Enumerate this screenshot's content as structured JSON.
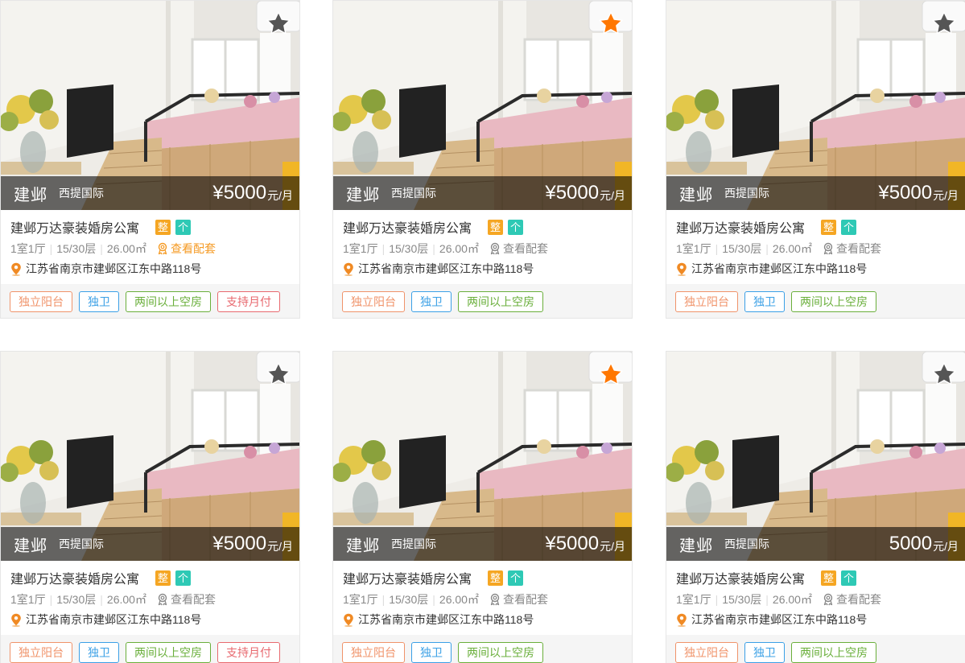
{
  "colors": {
    "accent_orange": "#f5a623",
    "accent_teal": "#2ec9b5",
    "star_active": "#ff7700",
    "star_inactive": "#555555",
    "tag_orange": "#f0936a",
    "tag_blue": "#3ba0e6",
    "tag_green": "#6aaf3b",
    "tag_red": "#e8696f"
  },
  "listings": [
    {
      "favorited": false,
      "district": "建邺",
      "community": "西提国际",
      "price": "¥5000",
      "price_unit": "元/月",
      "title": "建邺万达豪装婚房公寓",
      "type_tags": [
        "整",
        "个"
      ],
      "layout": "1室1厅",
      "floor": "15/30层",
      "area": "26.00㎡",
      "config_label": "查看配套",
      "config_active": true,
      "address": "江苏省南京市建邺区江东中路118号",
      "features": [
        "独立阳台",
        "独卫",
        "两间以上空房",
        "支持月付"
      ]
    },
    {
      "favorited": true,
      "district": "建邺",
      "community": "西提国际",
      "price": "¥5000",
      "price_unit": "元/月",
      "title": "建邺万达豪装婚房公寓",
      "type_tags": [
        "整",
        "个"
      ],
      "layout": "1室1厅",
      "floor": "15/30层",
      "area": "26.00㎡",
      "config_label": "查看配套",
      "config_active": false,
      "address": "江苏省南京市建邺区江东中路118号",
      "features": [
        "独立阳台",
        "独卫",
        "两间以上空房"
      ]
    },
    {
      "favorited": false,
      "district": "建邺",
      "community": "西提国际",
      "price": "¥5000",
      "price_unit": "元/月",
      "title": "建邺万达豪装婚房公寓",
      "type_tags": [
        "整",
        "个"
      ],
      "layout": "1室1厅",
      "floor": "15/30层",
      "area": "26.00㎡",
      "config_label": "查看配套",
      "config_active": false,
      "address": "江苏省南京市建邺区江东中路118号",
      "features": [
        "独立阳台",
        "独卫",
        "两间以上空房"
      ]
    },
    {
      "favorited": false,
      "district": "建邺",
      "community": "西提国际",
      "price": "¥5000",
      "price_unit": "元/月",
      "title": "建邺万达豪装婚房公寓",
      "type_tags": [
        "整",
        "个"
      ],
      "layout": "1室1厅",
      "floor": "15/30层",
      "area": "26.00㎡",
      "config_label": "查看配套",
      "config_active": false,
      "address": "江苏省南京市建邺区江东中路118号",
      "features": [
        "独立阳台",
        "独卫",
        "两间以上空房",
        "支持月付"
      ]
    },
    {
      "favorited": true,
      "district": "建邺",
      "community": "西提国际",
      "price": "¥5000",
      "price_unit": "元/月",
      "title": "建邺万达豪装婚房公寓",
      "type_tags": [
        "整",
        "个"
      ],
      "layout": "1室1厅",
      "floor": "15/30层",
      "area": "26.00㎡",
      "config_label": "查看配套",
      "config_active": false,
      "address": "江苏省南京市建邺区江东中路118号",
      "features": [
        "独立阳台",
        "独卫",
        "两间以上空房"
      ]
    },
    {
      "favorited": false,
      "district": "建邺",
      "community": "西提国际",
      "price": "5000",
      "price_unit": "元/月",
      "title": "建邺万达豪装婚房公寓",
      "type_tags": [
        "整",
        "个"
      ],
      "layout": "1室1厅",
      "floor": "15/30层",
      "area": "26.00㎡",
      "config_label": "查看配套",
      "config_active": false,
      "address": "江苏省南京市建邺区江东中路118号",
      "features": [
        "独立阳台",
        "独卫",
        "两间以上空房"
      ]
    }
  ]
}
